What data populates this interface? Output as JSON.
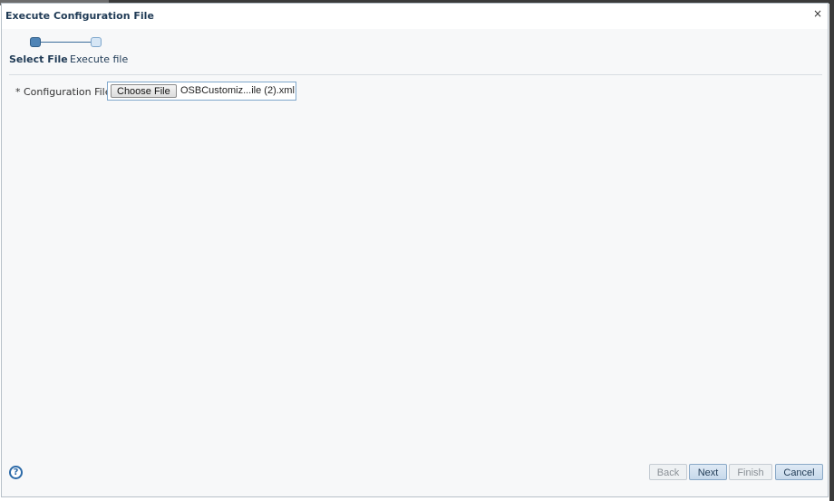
{
  "dialog": {
    "title": "Execute Configuration File",
    "close_symbol": "×"
  },
  "train": {
    "steps": [
      {
        "label": "Select File",
        "state": "current"
      },
      {
        "label": "Execute file",
        "state": "next"
      }
    ]
  },
  "form": {
    "config_file": {
      "label": "* Configuration File",
      "button_label": "Choose File",
      "file_name": "OSBCustomiz...ile (2).xml"
    }
  },
  "footer": {
    "help_symbol": "?",
    "buttons": {
      "back": {
        "label": "Back",
        "enabled": false
      },
      "next": {
        "label": "Next",
        "enabled": true
      },
      "finish": {
        "label": "Finish",
        "enabled": false
      },
      "cancel": {
        "label": "Cancel",
        "enabled": true
      }
    }
  },
  "colors": {
    "title": "#1f3a55",
    "accent": "#4f84b6",
    "help": "#2c6aa8"
  },
  "icons": {
    "close": "close-icon",
    "help": "help-icon"
  }
}
